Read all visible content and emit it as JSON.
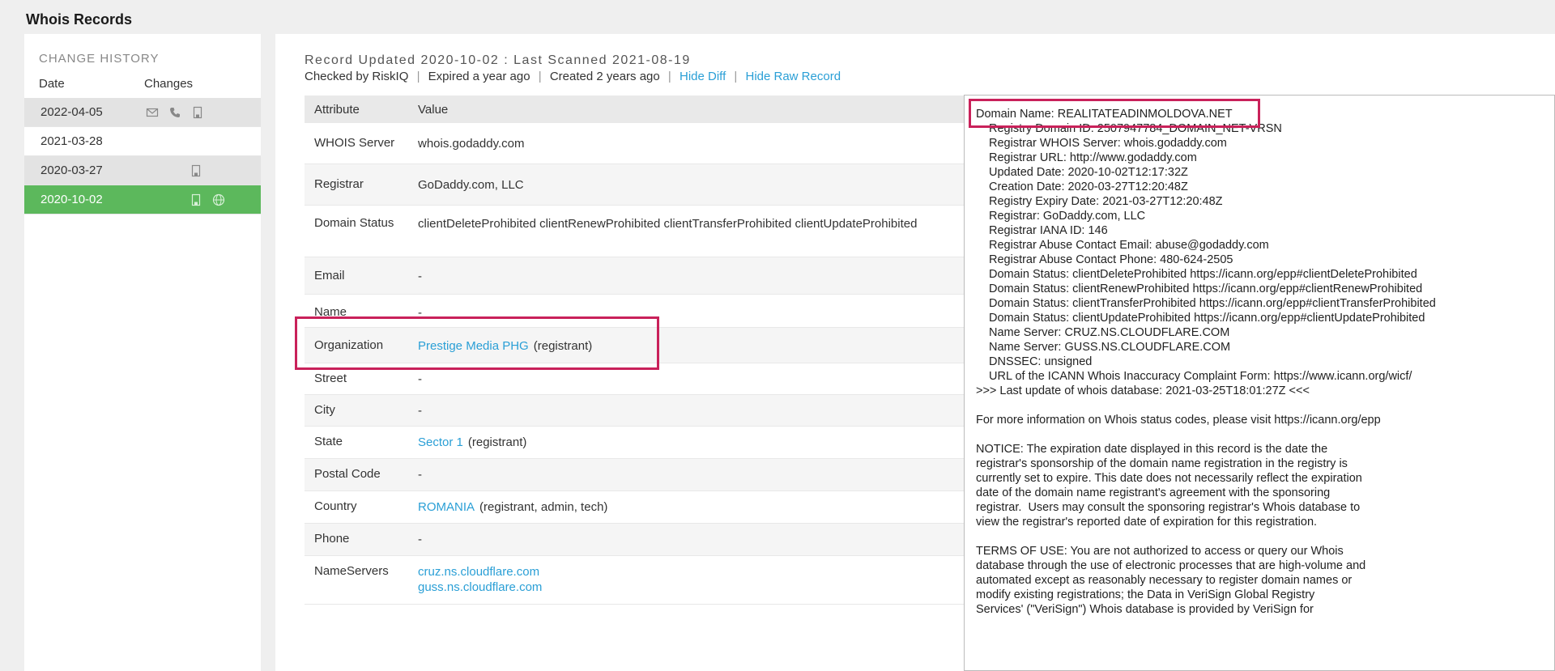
{
  "page_title": "Whois Records",
  "sidebar": {
    "title": "CHANGE HISTORY",
    "col_date": "Date",
    "col_changes": "Changes",
    "rows": [
      {
        "date": "2022-04-05",
        "icons": [
          "envelope-icon",
          "phone-icon",
          "building-icon"
        ],
        "state": "shaded"
      },
      {
        "date": "2021-03-28",
        "icons": [],
        "state": "plain"
      },
      {
        "date": "2020-03-27",
        "icons": [
          "building-icon"
        ],
        "state": "shaded"
      },
      {
        "date": "2020-10-02",
        "icons": [
          "building-icon",
          "globe-icon"
        ],
        "state": "selected"
      }
    ]
  },
  "record": {
    "updated_line": "Record Updated 2020-10-02 : Last Scanned 2021-08-19",
    "checked_by": "Checked by RiskIQ",
    "expired": "Expired a year ago",
    "created": "Created 2 years ago",
    "hide_diff": "Hide Diff",
    "hide_raw": "Hide Raw Record",
    "sep": "|"
  },
  "table": {
    "head_attribute": "Attribute",
    "head_value": "Value",
    "rows": {
      "whois_server": {
        "label": "WHOIS Server",
        "value": "whois.godaddy.com"
      },
      "registrar": {
        "label": "Registrar",
        "value": "GoDaddy.com, LLC"
      },
      "domain_status": {
        "label": "Domain Status",
        "value": "clientDeleteProhibited clientRenewProhibited clientTransferProhibited clientUpdateProhibited"
      },
      "email": {
        "label": "Email",
        "value": "-"
      },
      "name": {
        "label": "Name",
        "value": "-"
      },
      "organization": {
        "label": "Organization",
        "link": "Prestige Media PHG",
        "note": "(registrant)"
      },
      "street": {
        "label": "Street",
        "value": "-"
      },
      "city": {
        "label": "City",
        "value": "-"
      },
      "state": {
        "label": "State",
        "link": "Sector 1",
        "note": "(registrant)"
      },
      "postal_code": {
        "label": "Postal Code",
        "value": "-"
      },
      "country": {
        "label": "Country",
        "link": "ROMANIA",
        "note": "(registrant, admin, tech)"
      },
      "phone": {
        "label": "Phone",
        "value": "-"
      },
      "nameservers": {
        "label": "NameServers",
        "ns1": "cruz.ns.cloudflare.com",
        "ns2": "guss.ns.cloudflare.com"
      }
    }
  },
  "raw_record": {
    "first_line": "Domain Name: REALITATEADINMOLDOVA.NET",
    "indented_lines": [
      "Registry Domain ID: 2507947784_DOMAIN_NET-VRSN",
      "Registrar WHOIS Server: whois.godaddy.com",
      "Registrar URL: http://www.godaddy.com",
      "Updated Date: 2020-10-02T12:17:32Z",
      "Creation Date: 2020-03-27T12:20:48Z",
      "Registry Expiry Date: 2021-03-27T12:20:48Z",
      "Registrar: GoDaddy.com, LLC",
      "Registrar IANA ID: 146",
      "Registrar Abuse Contact Email: abuse@godaddy.com",
      "Registrar Abuse Contact Phone: 480-624-2505",
      "Domain Status: clientDeleteProhibited https://icann.org/epp#clientDeleteProhibited",
      "Domain Status: clientRenewProhibited https://icann.org/epp#clientRenewProhibited",
      "Domain Status: clientTransferProhibited https://icann.org/epp#clientTransferProhibited",
      "Domain Status: clientUpdateProhibited https://icann.org/epp#clientUpdateProhibited",
      "Name Server: CRUZ.NS.CLOUDFLARE.COM",
      "Name Server: GUSS.NS.CLOUDFLARE.COM",
      "DNSSEC: unsigned",
      "URL of the ICANN Whois Inaccuracy Complaint Form: https://www.icann.org/wicf/"
    ],
    "last_update": ">>> Last update of whois database: 2021-03-25T18:01:27Z <<<",
    "more_info": "For more information on Whois status codes, please visit https://icann.org/epp",
    "notice_lines": [
      "NOTICE: The expiration date displayed in this record is the date the",
      "registrar's sponsorship of the domain name registration in the registry is",
      "currently set to expire. This date does not necessarily reflect the expiration",
      "date of the domain name registrant's agreement with the sponsoring",
      "registrar.  Users may consult the sponsoring registrar's Whois database to",
      "view the registrar's reported date of expiration for this registration."
    ],
    "terms_lines": [
      "TERMS OF USE: You are not authorized to access or query our Whois",
      "database through the use of electronic processes that are high-volume and",
      "automated except as reasonably necessary to register domain names or",
      "modify existing registrations; the Data in VeriSign Global Registry",
      "Services' (\"VeriSign\") Whois database is provided by VeriSign for"
    ]
  },
  "colors": {
    "selected_row": "#5cb85c",
    "link": "#2a9fd6",
    "highlight_box": "#c9215a"
  }
}
